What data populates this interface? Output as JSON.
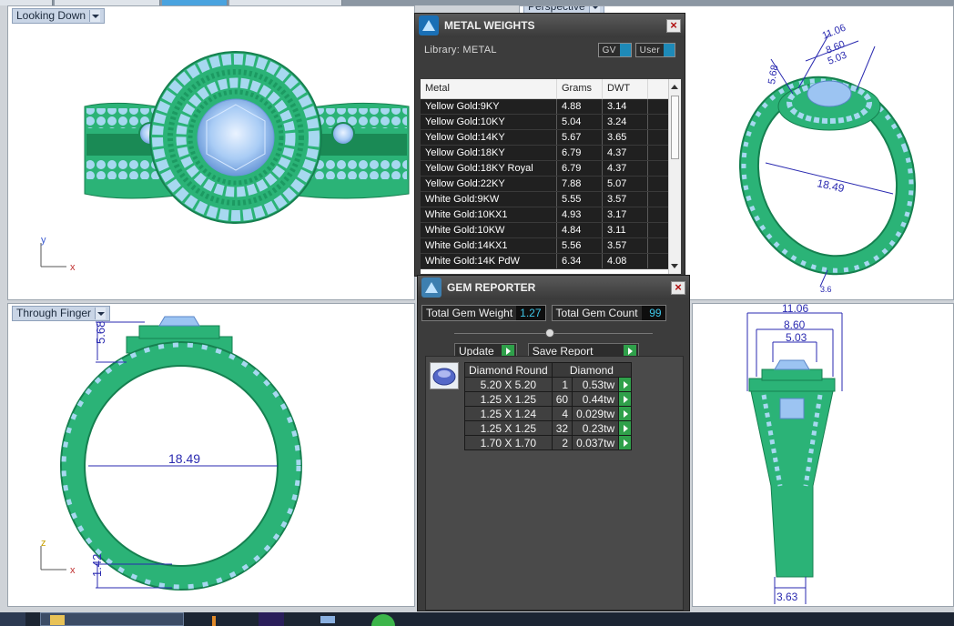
{
  "viewports": {
    "top_left": {
      "label": "Looking Down",
      "axis_v": "y",
      "axis_h": "x"
    },
    "bottom_left": {
      "label": "Through Finger",
      "axis_v": "z",
      "axis_h": "x",
      "dim_height": "5.68",
      "dim_diameter": "18.49",
      "dim_band": "1.42"
    },
    "top_right": {
      "label": "Perspective",
      "dim_a": "11.06",
      "dim_b": "8.60",
      "dim_c": "5.03",
      "dim_height": "5.68",
      "dim_diameter": "18.49",
      "dim_small": "3.6"
    },
    "bottom_right": {
      "dim_a": "11.06",
      "dim_b": "8.60",
      "dim_c": "5.03",
      "dim_shank": "3.63"
    }
  },
  "metal_weights": {
    "title": "METAL WEIGHTS",
    "library_label": "Library: METAL",
    "gv_label": "GV",
    "user_label": "User",
    "columns": [
      "Metal",
      "Grams",
      "DWT"
    ],
    "rows": [
      [
        "Yellow Gold:9KY",
        "4.88",
        "3.14"
      ],
      [
        "Yellow Gold:10KY",
        "5.04",
        "3.24"
      ],
      [
        "Yellow Gold:14KY",
        "5.67",
        "3.65"
      ],
      [
        "Yellow Gold:18KY",
        "6.79",
        "4.37"
      ],
      [
        "Yellow Gold:18KY Royal",
        "6.79",
        "4.37"
      ],
      [
        "Yellow Gold:22KY",
        "7.88",
        "5.07"
      ],
      [
        "White Gold:9KW",
        "5.55",
        "3.57"
      ],
      [
        "White Gold:10KX1",
        "4.93",
        "3.17"
      ],
      [
        "White Gold:10KW",
        "4.84",
        "3.11"
      ],
      [
        "White Gold:14KX1",
        "5.56",
        "3.57"
      ],
      [
        "White Gold:14K PdW",
        "6.34",
        "4.08"
      ]
    ]
  },
  "gem_reporter": {
    "title": "GEM REPORTER",
    "total_weight_label": "Total Gem Weight",
    "total_weight_value": "1.27",
    "total_count_label": "Total Gem Count",
    "total_count_value": "99",
    "update_label": "Update",
    "save_report_label": "Save Report",
    "table_header_shape": "Diamond Round",
    "table_header_material": "Diamond",
    "rows": [
      [
        "5.20 X 5.20",
        "1",
        "0.53tw"
      ],
      [
        "1.25 X 1.25",
        "60",
        "0.44tw"
      ],
      [
        "1.25 X 1.24",
        "4",
        "0.029tw"
      ],
      [
        "1.25 X 1.25",
        "32",
        "0.23tw"
      ],
      [
        "1.70 X 1.70",
        "2",
        "0.037tw"
      ]
    ]
  },
  "colors": {
    "ring_green": "#2fbf7e",
    "ring_dark": "#1a8a55",
    "gem_blue": "#9cc4f2",
    "dimension_blue": "#2a2ab0",
    "panel_bg": "#3c3c3c"
  }
}
